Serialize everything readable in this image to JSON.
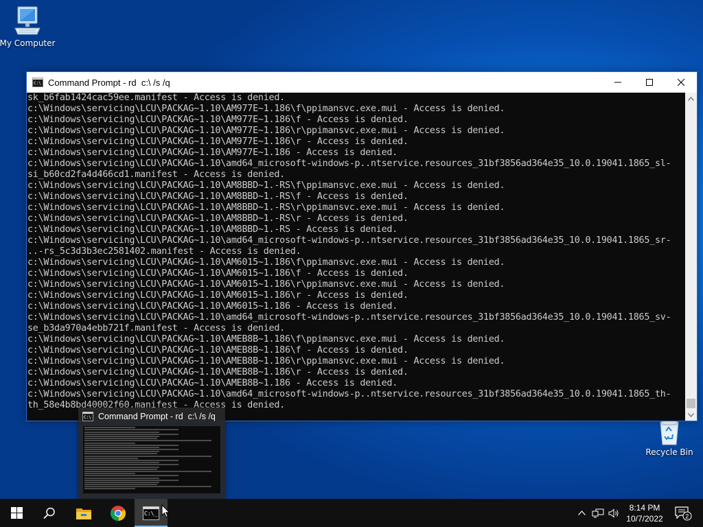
{
  "desktop": {
    "icons": [
      {
        "label": "My Computer"
      },
      {
        "label": "Recycle Bin"
      }
    ]
  },
  "window": {
    "title": "Command Prompt - rd  c:\\ /s /q",
    "controls": [
      "minimize-icon",
      "maximize-icon",
      "close-icon"
    ]
  },
  "console": {
    "lines": [
      "sk_b6fab1424cac59ee.manifest - Access is denied.",
      "c:\\Windows\\servicing\\LCU\\PACKAG~1.10\\AM977E~1.186\\f\\ppimansvc.exe.mui - Access is denied.",
      "c:\\Windows\\servicing\\LCU\\PACKAG~1.10\\AM977E~1.186\\f - Access is denied.",
      "c:\\Windows\\servicing\\LCU\\PACKAG~1.10\\AM977E~1.186\\r\\ppimansvc.exe.mui - Access is denied.",
      "c:\\Windows\\servicing\\LCU\\PACKAG~1.10\\AM977E~1.186\\r - Access is denied.",
      "c:\\Windows\\servicing\\LCU\\PACKAG~1.10\\AM977E~1.186 - Access is denied.",
      "c:\\Windows\\servicing\\LCU\\PACKAG~1.10\\amd64_microsoft-windows-p..ntservice.resources_31bf3856ad364e35_10.0.19041.1865_sl-",
      "si_b60cd2fa4d466cd1.manifest - Access is denied.",
      "c:\\Windows\\servicing\\LCU\\PACKAG~1.10\\AM8BBD~1.-RS\\f\\ppimansvc.exe.mui - Access is denied.",
      "c:\\Windows\\servicing\\LCU\\PACKAG~1.10\\AM8BBD~1.-RS\\f - Access is denied.",
      "c:\\Windows\\servicing\\LCU\\PACKAG~1.10\\AM8BBD~1.-RS\\r\\ppimansvc.exe.mui - Access is denied.",
      "c:\\Windows\\servicing\\LCU\\PACKAG~1.10\\AM8BBD~1.-RS\\r - Access is denied.",
      "c:\\Windows\\servicing\\LCU\\PACKAG~1.10\\AM8BBD~1.-RS - Access is denied.",
      "c:\\Windows\\servicing\\LCU\\PACKAG~1.10\\amd64_microsoft-windows-p..ntservice.resources_31bf3856ad364e35_10.0.19041.1865_sr-",
      "..-rs_5c3d3b3ec2581402.manifest - Access is denied.",
      "c:\\Windows\\servicing\\LCU\\PACKAG~1.10\\AM6015~1.186\\f\\ppimansvc.exe.mui - Access is denied.",
      "c:\\Windows\\servicing\\LCU\\PACKAG~1.10\\AM6015~1.186\\f - Access is denied.",
      "c:\\Windows\\servicing\\LCU\\PACKAG~1.10\\AM6015~1.186\\r\\ppimansvc.exe.mui - Access is denied.",
      "c:\\Windows\\servicing\\LCU\\PACKAG~1.10\\AM6015~1.186\\r - Access is denied.",
      "c:\\Windows\\servicing\\LCU\\PACKAG~1.10\\AM6015~1.186 - Access is denied.",
      "c:\\Windows\\servicing\\LCU\\PACKAG~1.10\\amd64_microsoft-windows-p..ntservice.resources_31bf3856ad364e35_10.0.19041.1865_sv-",
      "se_b3da970a4ebb721f.manifest - Access is denied.",
      "c:\\Windows\\servicing\\LCU\\PACKAG~1.10\\AMEB8B~1.186\\f\\ppimansvc.exe.mui - Access is denied.",
      "c:\\Windows\\servicing\\LCU\\PACKAG~1.10\\AMEB8B~1.186\\f - Access is denied.",
      "c:\\Windows\\servicing\\LCU\\PACKAG~1.10\\AMEB8B~1.186\\r\\ppimansvc.exe.mui - Access is denied.",
      "c:\\Windows\\servicing\\LCU\\PACKAG~1.10\\AMEB8B~1.186\\r - Access is denied.",
      "c:\\Windows\\servicing\\LCU\\PACKAG~1.10\\AMEB8B~1.186 - Access is denied.",
      "c:\\Windows\\servicing\\LCU\\PACKAG~1.10\\amd64_microsoft-windows-p..ntservice.resources_31bf3856ad364e35_10.0.19041.1865_th-",
      "th_58e4b8bd40002f60.manifest - Access is denied."
    ]
  },
  "preview": {
    "title": "Command Prompt - rd  c:\\ /s /q"
  },
  "taskbar": {
    "items": [
      "windows-start-icon",
      "search-icon",
      "file-explorer-icon",
      "chrome-icon",
      "command-prompt-icon"
    ],
    "clock": {
      "time": "8:14 PM",
      "date": "10/7/2022"
    },
    "notification_count": "2"
  },
  "colors": {
    "console_bg": "#0c0c0c",
    "console_fg": "#cccccc",
    "taskbar_bg": "#101010",
    "accent": "#76b9ed"
  }
}
